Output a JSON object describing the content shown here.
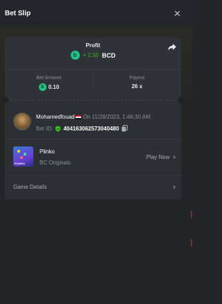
{
  "header": {
    "title": "Bet Slip",
    "close_icon": "close-icon"
  },
  "profit": {
    "label": "Profit",
    "coin_symbol": "b",
    "value": "+ 2.50",
    "currency": "BCD",
    "value_color": "#3bc117",
    "share_icon": "share-icon"
  },
  "stats": {
    "bet_amount_label": "Bet Amount",
    "bet_amount_value": "0.10",
    "payout_label": "Payout",
    "payout_value": "26 x"
  },
  "user": {
    "name": "Mohamedfouad",
    "date": "On 11/28/2023, 1:46:30 AM",
    "bet_id_label": "Bet ID:",
    "bet_id": "404163062573040480"
  },
  "game": {
    "name": "Plinko",
    "provider": "BC Originals",
    "thumb_text": "PLINKO",
    "play_label": "Play Now"
  },
  "details": {
    "label": "Game Details"
  },
  "colors": {
    "accent_green": "#21c38a",
    "background": "#232528",
    "card": "#2c2f34"
  }
}
